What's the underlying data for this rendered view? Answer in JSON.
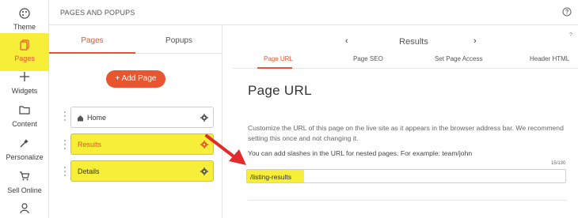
{
  "rail": {
    "items": [
      {
        "label": "Theme"
      },
      {
        "label": "Pages"
      },
      {
        "label": "Widgets"
      },
      {
        "label": "Content"
      },
      {
        "label": "Personalize"
      },
      {
        "label": "Sell Online"
      }
    ]
  },
  "header": {
    "title": "PAGES AND POPUPS"
  },
  "panel": {
    "tabs": {
      "pages": "Pages",
      "popups": "Popups"
    },
    "add_button": "+ Add Page",
    "pages": [
      {
        "label": "Home"
      },
      {
        "label": "Results"
      },
      {
        "label": "Details"
      }
    ]
  },
  "settings": {
    "nav": {
      "prev": "‹",
      "next": "›",
      "title": "Results"
    },
    "help": "?",
    "tabs": [
      "Page URL",
      "Page SEO",
      "Set Page Access",
      "Header HTML"
    ],
    "heading": "Page URL",
    "description": "Customize the URL of this page on the live site as it appears in the browser address bar. We recommend setting this once and not changing it.",
    "note": "You can add slashes in the URL for nested pages. For example: team/john",
    "counter": "15/130",
    "url_value": "/listing-results"
  },
  "colors": {
    "accent": "#e8552e",
    "highlight": "#f7ee3a"
  }
}
